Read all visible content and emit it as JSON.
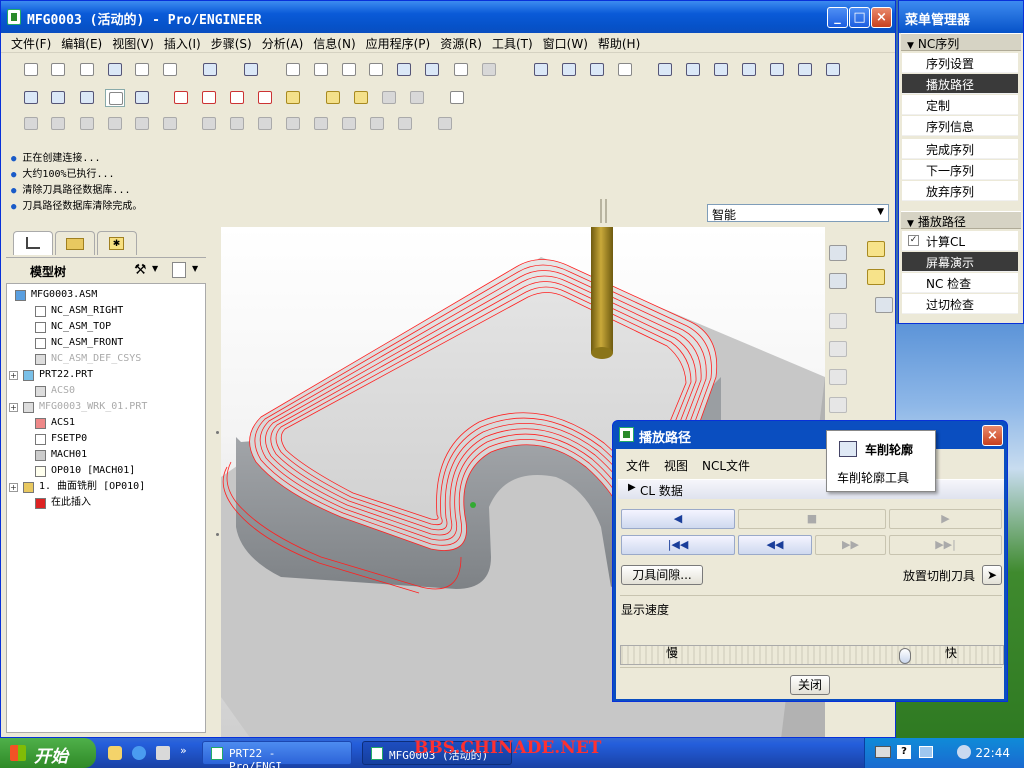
{
  "window": {
    "title": "MFG0003 (活动的) - Pro/ENGINEER"
  },
  "menubar": [
    "文件(F)",
    "编辑(E)",
    "视图(V)",
    "插入(I)",
    "步骤(S)",
    "分析(A)",
    "信息(N)",
    "应用程序(P)",
    "资源(R)",
    "工具(T)",
    "窗口(W)",
    "帮助(H)"
  ],
  "messages": [
    "正在创建连接...",
    "大约100%已执行...",
    "清除刀具路径数据库...",
    "刀具路径数据库清除完成。"
  ],
  "filter": {
    "value": "智能"
  },
  "model_tree": {
    "title": "模型树",
    "items": [
      {
        "label": "MFG0003.ASM",
        "dim": false
      },
      {
        "label": "NC_ASM_RIGHT",
        "dim": false
      },
      {
        "label": "NC_ASM_TOP",
        "dim": false
      },
      {
        "label": "NC_ASM_FRONT",
        "dim": false
      },
      {
        "label": "NC_ASM_DEF_CSYS",
        "dim": true
      },
      {
        "label": "PRT22.PRT",
        "dim": false
      },
      {
        "label": "ACS0",
        "dim": true
      },
      {
        "label": "MFG0003_WRK_01.PRT",
        "dim": true
      },
      {
        "label": "ACS1",
        "dim": false
      },
      {
        "label": "FSETP0",
        "dim": false
      },
      {
        "label": "MACH01",
        "dim": false
      },
      {
        "label": "OP010 [MACH01]",
        "dim": false
      },
      {
        "label": "1. 曲面铣削 [OP010]",
        "dim": false
      },
      {
        "label": "在此插入",
        "dim": false
      }
    ]
  },
  "menu_manager": {
    "title": "菜单管理器",
    "nc_sequence": {
      "header": "NC序列",
      "items": [
        "序列设置",
        "播放路径",
        "定制",
        "序列信息",
        "完成序列",
        "下一序列",
        "放弃序列"
      ],
      "highlighted": "播放路径"
    },
    "play_path": {
      "header": "播放路径",
      "items": [
        "计算CL",
        "屏幕演示",
        "NC 检查",
        "过切检查"
      ],
      "checked": "计算CL",
      "highlighted": "屏幕演示"
    }
  },
  "tooltip": {
    "title": "车削轮廓",
    "description": "车削轮廓工具"
  },
  "dialog": {
    "title": "播放路径",
    "menu": [
      "文件",
      "视图",
      "NCL文件"
    ],
    "cl_section": "CL 数据",
    "tool_clearance": "刀具间隙...",
    "place_cutter": "放置切削刀具",
    "speed_label": "显示速度",
    "slow": "慢",
    "fast": "快",
    "speed_value": 0.75,
    "close": "关闭"
  },
  "taskbar": {
    "start": "开始",
    "tasks": [
      "PRT22 - Pro/ENGI...",
      "MFG0003 (活动的)"
    ],
    "clock": "22:44"
  },
  "watermark": "BBS.CHINADE.NET"
}
